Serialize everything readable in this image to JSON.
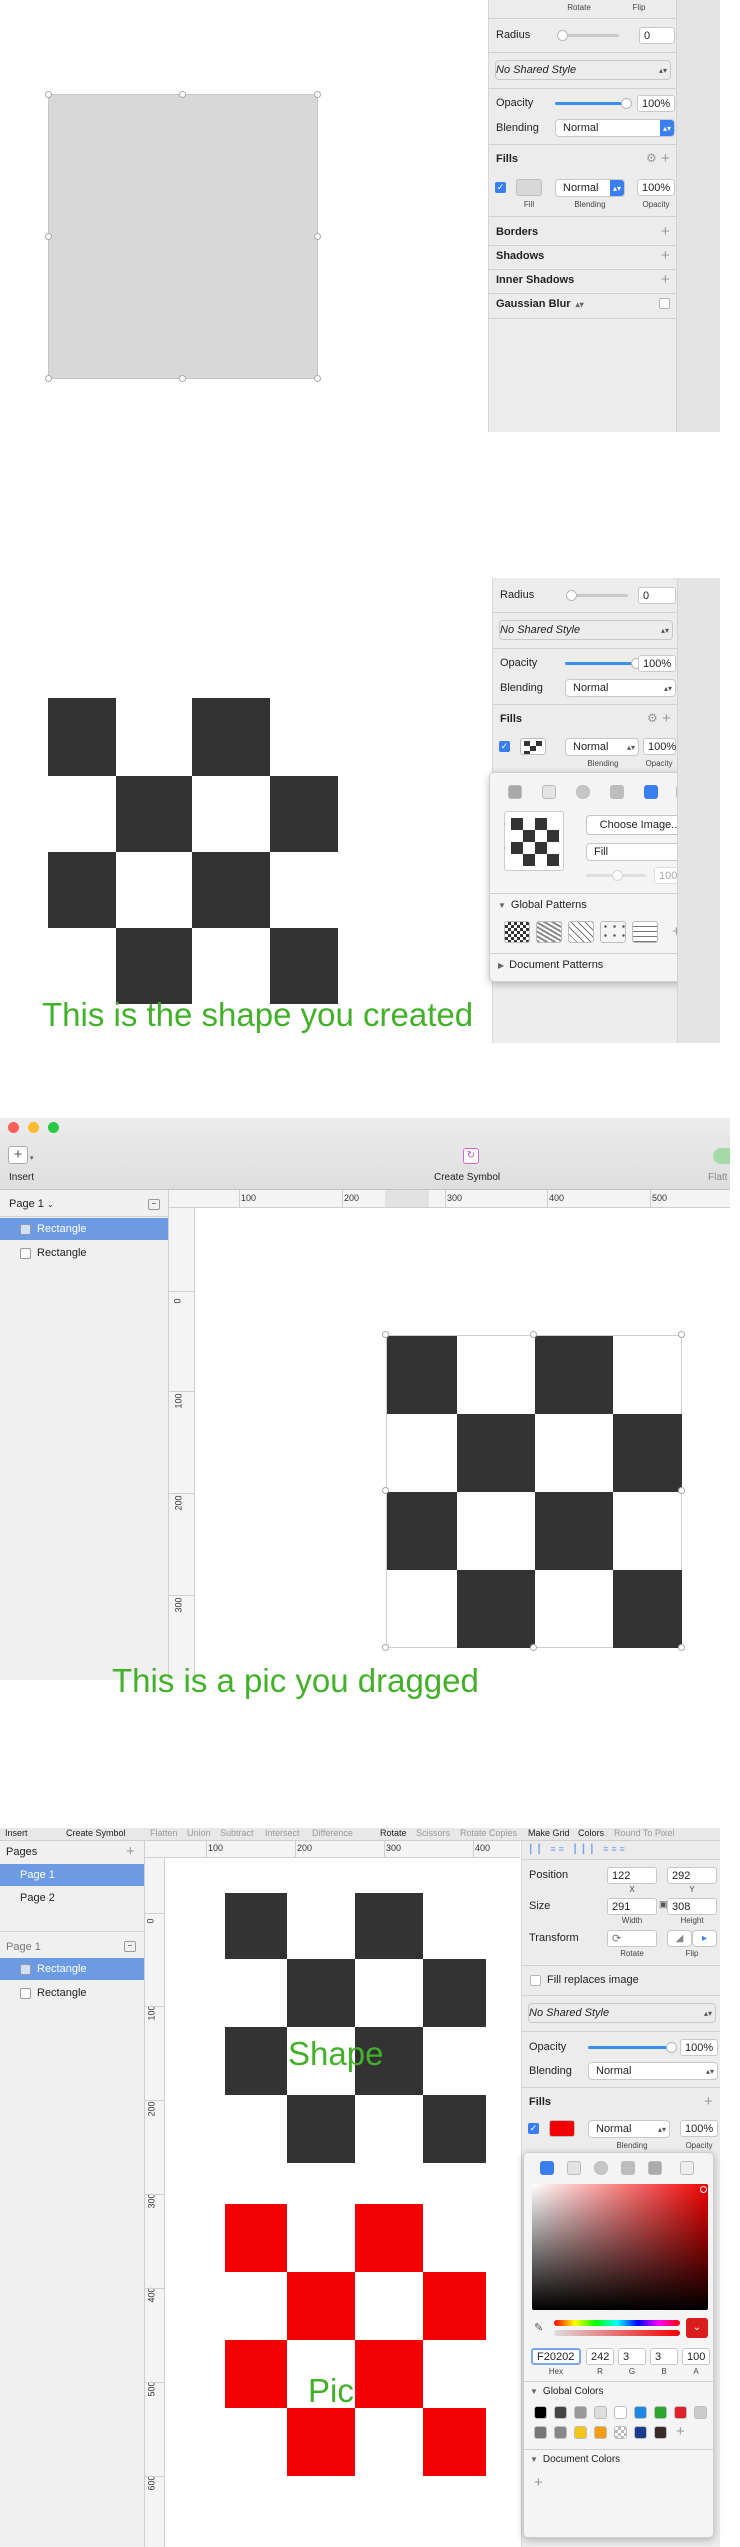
{
  "colors": {
    "accent": "#3a7ff0",
    "selection": "#6c9be3",
    "annotation": "#43b02a",
    "dark_square": "#333333",
    "red": "#f20202"
  },
  "section1": {
    "transform_labels": {
      "rotate": "Rotate",
      "flip": "Flip"
    },
    "radius_label": "Radius",
    "radius_value": "0",
    "shared_style": "No Shared Style",
    "opacity_label": "Opacity",
    "opacity_value": "100%",
    "opacity_level": 1.0,
    "blending_label": "Blending",
    "blending_value": "Normal",
    "fills_label": "Fills",
    "fill": {
      "blend": "Normal",
      "opacity": "100%",
      "sub_fill": "Fill",
      "sub_blending": "Blending",
      "sub_opacity": "Opacity"
    },
    "borders": "Borders",
    "shadows": "Shadows",
    "inner_shadows": "Inner Shadows",
    "gaussian_blur": "Gaussian Blur"
  },
  "section2": {
    "radius_label": "Radius",
    "radius_value": "0",
    "shared_style": "No Shared Style",
    "opacity_label": "Opacity",
    "opacity_value": "100%",
    "opacity_level": 1.0,
    "blending_label": "Blending",
    "blending_value": "Normal",
    "fills_label": "Fills",
    "fill": {
      "blend": "Normal",
      "opacity": "100%",
      "sub_blending": "Blending",
      "sub_opacity": "Opacity"
    },
    "popover": {
      "choose_image": "Choose Image...",
      "mode": "Fill",
      "opacity": "100%",
      "global_patterns": "Global Patterns",
      "document_patterns": "Document Patterns"
    },
    "caption": "This is the shape you created"
  },
  "section3": {
    "toolbar": {
      "insert": "Insert",
      "create_symbol": "Create Symbol",
      "flatten": "Flatt"
    },
    "page_selector": "Page 1",
    "layers": [
      {
        "name": "Rectangle",
        "active": true
      },
      {
        "name": "Rectangle",
        "active": false
      }
    ],
    "ruler_h": [
      "100",
      "200",
      "300",
      "400",
      "500"
    ],
    "ruler_v": [
      "0",
      "100",
      "200",
      "300"
    ],
    "caption": "This is a pic you dragged"
  },
  "section4": {
    "toolbar": [
      "Insert",
      "Create Symbol",
      "Flatten",
      "Union",
      "Subtract",
      "Intersect",
      "Difference",
      "Rotate",
      "Scissors",
      "Rotate Copies",
      "Make Grid",
      "Colors",
      "Round To Pixel"
    ],
    "pages_title": "Pages",
    "pages": [
      {
        "name": "Page 1",
        "active": true
      },
      {
        "name": "Page 2",
        "active": false
      }
    ],
    "page_label": "Page 1",
    "layers": [
      {
        "name": "Rectangle",
        "active": true
      },
      {
        "name": "Rectangle",
        "active": false
      }
    ],
    "ruler_h": [
      "100",
      "200",
      "300",
      "400"
    ],
    "ruler_v": [
      "0",
      "100",
      "200",
      "300",
      "400",
      "500",
      "600"
    ],
    "position_label": "Position",
    "pos_x": "122",
    "pos_y": "292",
    "x": "X",
    "y": "Y",
    "size_label": "Size",
    "width": "291",
    "height": "308",
    "width_label": "Width",
    "height_label": "Height",
    "transform_label": "Transform",
    "rotate": "Rotate",
    "flip": "Flip",
    "fill_replaces": "Fill replaces image",
    "shared_style": "No Shared Style",
    "opacity_label": "Opacity",
    "opacity_value": "100%",
    "opacity_level": 0.95,
    "blending_label": "Blending",
    "blending_value": "Normal",
    "fills_label": "Fills",
    "fill": {
      "blend": "Normal",
      "opacity": "100%",
      "sub_blending": "Blending",
      "sub_opacity": "Opacity"
    },
    "color": {
      "hex": "F20202",
      "r": "242",
      "g": "3",
      "b": "3",
      "a": "100",
      "hex_l": "Hex",
      "r_l": "R",
      "g_l": "G",
      "b_l": "B",
      "a_l": "A"
    },
    "global_colors": "Global Colors",
    "document_colors": "Document Colors",
    "shape_label": "Shape",
    "pic_label": "Pic"
  }
}
